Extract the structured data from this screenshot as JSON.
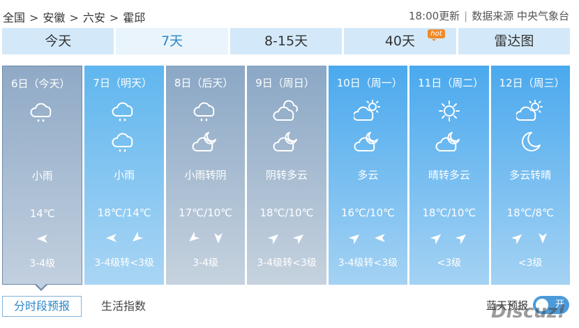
{
  "breadcrumb": [
    "全国",
    "安徽",
    "六安",
    "霍邱"
  ],
  "breadcrumb_sep": ">",
  "update_time": "18:00更新",
  "source": "数据来源 中央气象台",
  "tabs": [
    {
      "label": "今天"
    },
    {
      "label": "7天",
      "active": true
    },
    {
      "label": "8-15天"
    },
    {
      "label": "40天",
      "badge": "hot"
    },
    {
      "label": "雷达图"
    }
  ],
  "days": [
    {
      "date": "6日（今天）",
      "icon1": "rain-cloud-icon",
      "icon2": "",
      "weather": "小雨",
      "temp": "14℃",
      "wind": [
        "west"
      ],
      "level": "3-4级",
      "style": "today"
    },
    {
      "date": "7日（明天）",
      "icon1": "rain-cloud-icon",
      "icon2": "rain-cloud-icon",
      "weather": "小雨",
      "temp": "18℃/14℃",
      "wind": [
        "west",
        "southwest"
      ],
      "level": "3-4级转<3级",
      "style": "rain"
    },
    {
      "date": "8日（后天）",
      "icon1": "rain-cloud-icon",
      "icon2": "cloud-moon-icon",
      "weather": "小雨转阴",
      "temp": "17℃/10℃",
      "wind": [
        "southwest",
        "south"
      ],
      "level": "3-4级",
      "style": "grey"
    },
    {
      "date": "9日（周日）",
      "icon1": "overcast-icon",
      "icon2": "cloud-moon-icon",
      "weather": "阴转多云",
      "temp": "18℃/10℃",
      "wind": [
        "northeast",
        "northeast"
      ],
      "level": "3-4级转<3级",
      "style": "grey"
    },
    {
      "date": "10日（周一）",
      "icon1": "partly-cloudy-icon",
      "icon2": "cloud-moon-icon",
      "weather": "多云",
      "temp": "16℃/10℃",
      "wind": [
        "northeast",
        "west"
      ],
      "level": "3-4级转<3级",
      "style": "blue"
    },
    {
      "date": "11日（周二）",
      "icon1": "sun-icon",
      "icon2": "cloud-moon-icon",
      "weather": "晴转多云",
      "temp": "18℃/10℃",
      "wind": [
        "northeast",
        "northeast"
      ],
      "level": "<3级",
      "style": "blue"
    },
    {
      "date": "12日（周三）",
      "icon1": "partly-cloudy-icon",
      "icon2": "moon-icon",
      "weather": "多云转晴",
      "temp": "18℃/8℃",
      "wind": [
        "northeast",
        "south"
      ],
      "level": "<3级",
      "style": "blue"
    }
  ],
  "bottom_tabs": {
    "hourly": "分时段预报",
    "life": "生活指数"
  },
  "alert_label": "蓝天预报",
  "toggle_label": "开",
  "watermark": "Discuz!"
}
